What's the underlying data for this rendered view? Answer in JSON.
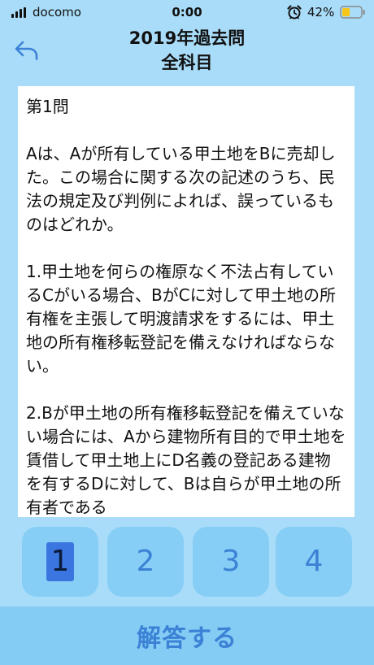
{
  "status_bar": {
    "carrier": "docomo",
    "time": "0:00",
    "battery_percent": "42%",
    "battery_level": 0.42,
    "signal_icon": "signal-bars-icon",
    "alarm_icon": "alarm-clock-icon",
    "battery_icon": "battery-icon"
  },
  "nav": {
    "title_line1": "2019年過去問",
    "title_line2": "全科目",
    "back_icon": "back-arrow-icon"
  },
  "question": {
    "text": "第1問\n\nAは、Aが所有している甲土地をBに売却した。この場合に関する次の記述のうち、民法の規定及び判例によれば、誤っているものはどれか。\n\n1.甲土地を何らの権原なく不法占有しているCがいる場合、BがCに対して甲土地の所有権を主張して明渡請求をするには、甲土地の所有権移転登記を備えなければならない。\n\n2.Bが甲土地の所有権移転登記を備えていない場合には、Aから建物所有目的で甲土地を賃借して甲土地上にD名義の登記ある建物を有するDに対して、Bは自らが甲土地の所有者である"
  },
  "choices": [
    {
      "label": "1",
      "selected": true
    },
    {
      "label": "2",
      "selected": false
    },
    {
      "label": "3",
      "selected": false
    },
    {
      "label": "4",
      "selected": false
    }
  ],
  "submit_label": "解答する",
  "colors": {
    "background": "#a9dcf8",
    "button": "#86cef5",
    "accent": "#3b82d6",
    "selected": "#3b76e0",
    "card": "#ffffff",
    "battery_fill": "#f5c518"
  }
}
